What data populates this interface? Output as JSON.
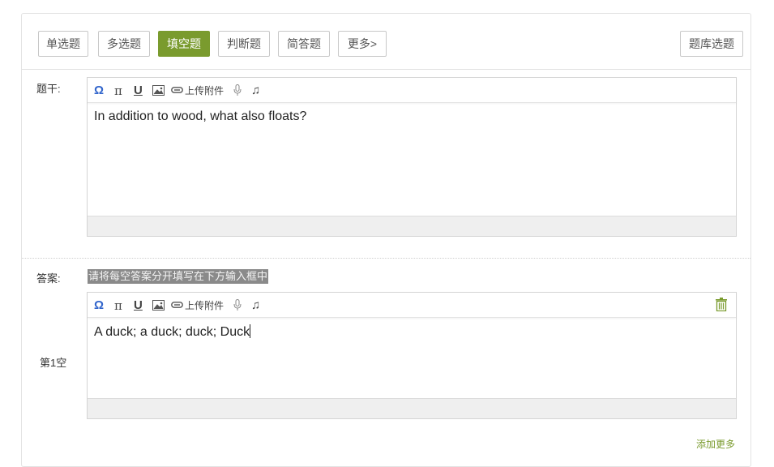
{
  "question_types": {
    "single": "单选题",
    "multiple": "多选题",
    "fill_blank": "填空题",
    "judge": "判断题",
    "short_answer": "简答题",
    "more": "更多>",
    "bank": "题库选题"
  },
  "stem": {
    "label": "题干:",
    "content": "In addition to wood, what also floats?"
  },
  "toolbar": {
    "upload_label": "上传附件"
  },
  "answer": {
    "label": "答案:",
    "hint": "请将每空答案分开填写在下方输入框中",
    "blank_label": "第1空",
    "content": "A duck; a duck; duck; Duck",
    "add_more": "添加更多"
  },
  "colors": {
    "accent": "#7a9b2e",
    "icon_blue": "#3366cc"
  }
}
